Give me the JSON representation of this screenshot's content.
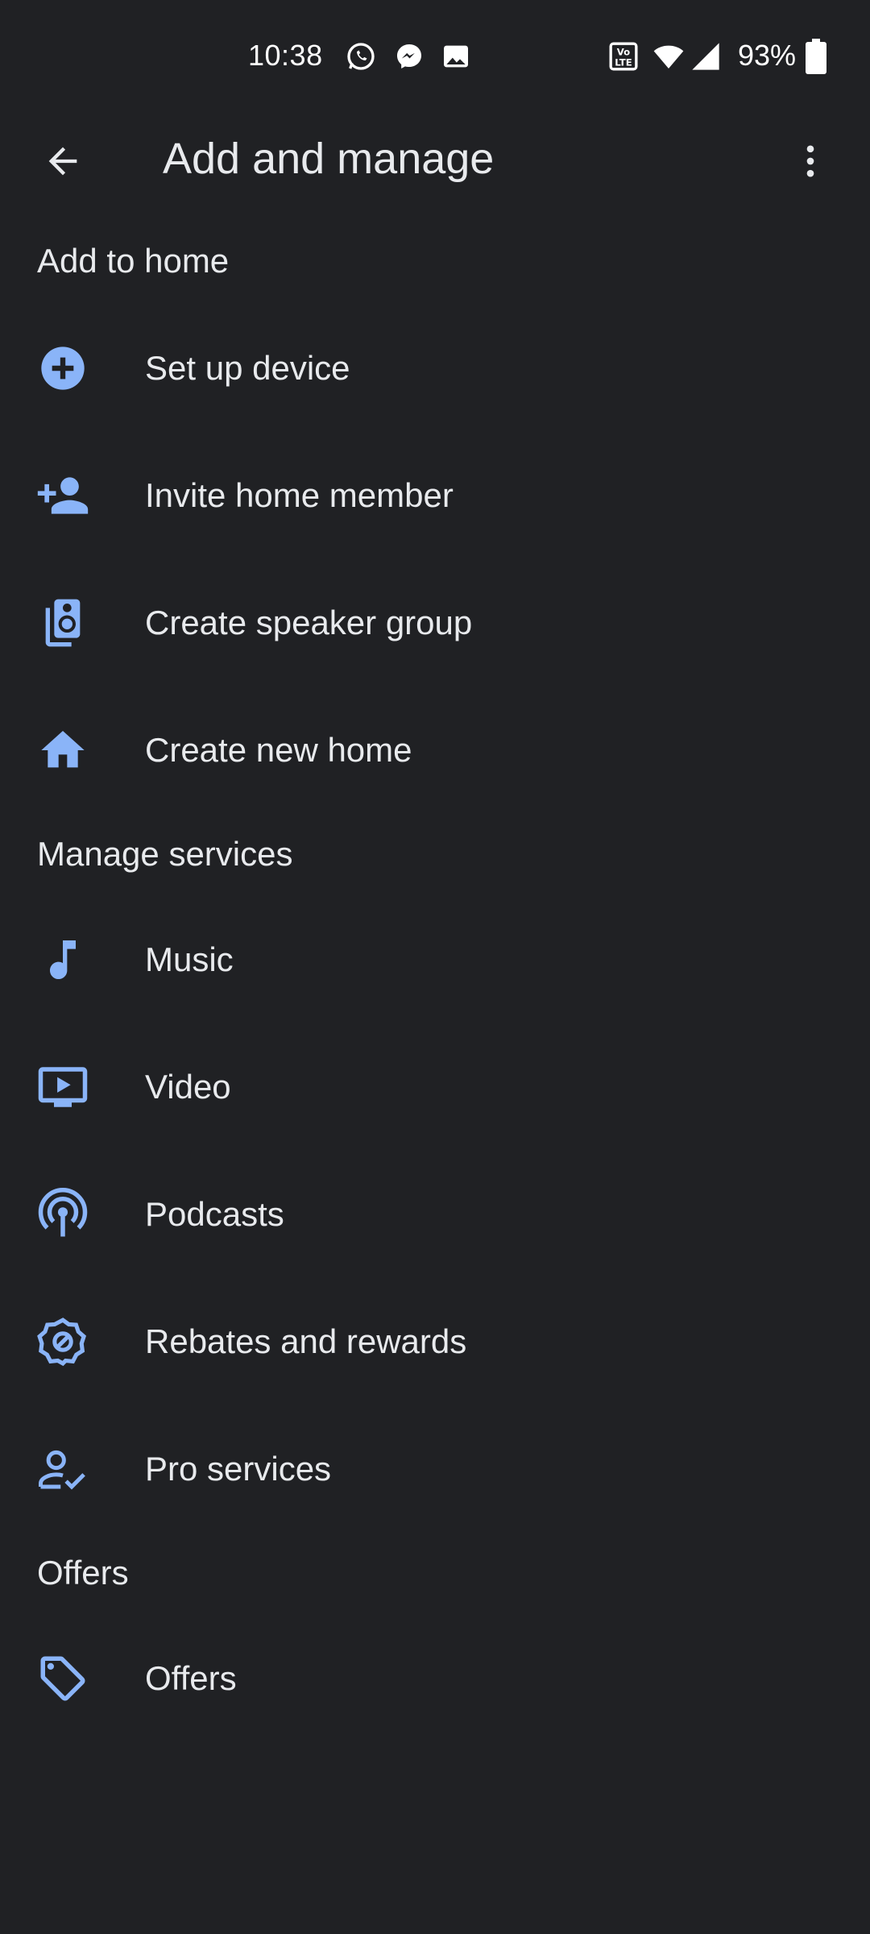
{
  "status_bar": {
    "time": "10:38",
    "battery": "93%",
    "icons": [
      "whatsapp-icon",
      "messenger-icon",
      "gallery-icon",
      "volte-icon",
      "wifi-icon",
      "signal-icon",
      "battery-icon"
    ]
  },
  "app_bar": {
    "title": "Add and manage",
    "back_icon": "arrow-back-icon",
    "menu_icon": "more-vert-icon"
  },
  "sections": {
    "add_to_home": {
      "header": "Add to home",
      "items": [
        {
          "label": "Set up device",
          "icon": "add-circle-icon"
        },
        {
          "label": "Invite home member",
          "icon": "person-add-icon"
        },
        {
          "label": "Create speaker group",
          "icon": "speaker-group-icon"
        },
        {
          "label": "Create new home",
          "icon": "home-icon"
        }
      ]
    },
    "manage_services": {
      "header": "Manage services",
      "items": [
        {
          "label": "Music",
          "icon": "music-note-icon"
        },
        {
          "label": "Video",
          "icon": "video-icon"
        },
        {
          "label": "Podcasts",
          "icon": "podcast-icon"
        },
        {
          "label": "Rebates and rewards",
          "icon": "rewards-icon"
        },
        {
          "label": "Pro services",
          "icon": "pro-services-icon"
        }
      ]
    },
    "offers": {
      "header": "Offers",
      "items": [
        {
          "label": "Offers",
          "icon": "tag-icon"
        }
      ]
    }
  },
  "colors": {
    "background": "#202124",
    "text": "#e8eaed",
    "accent_icon": "#8ab4f8"
  }
}
